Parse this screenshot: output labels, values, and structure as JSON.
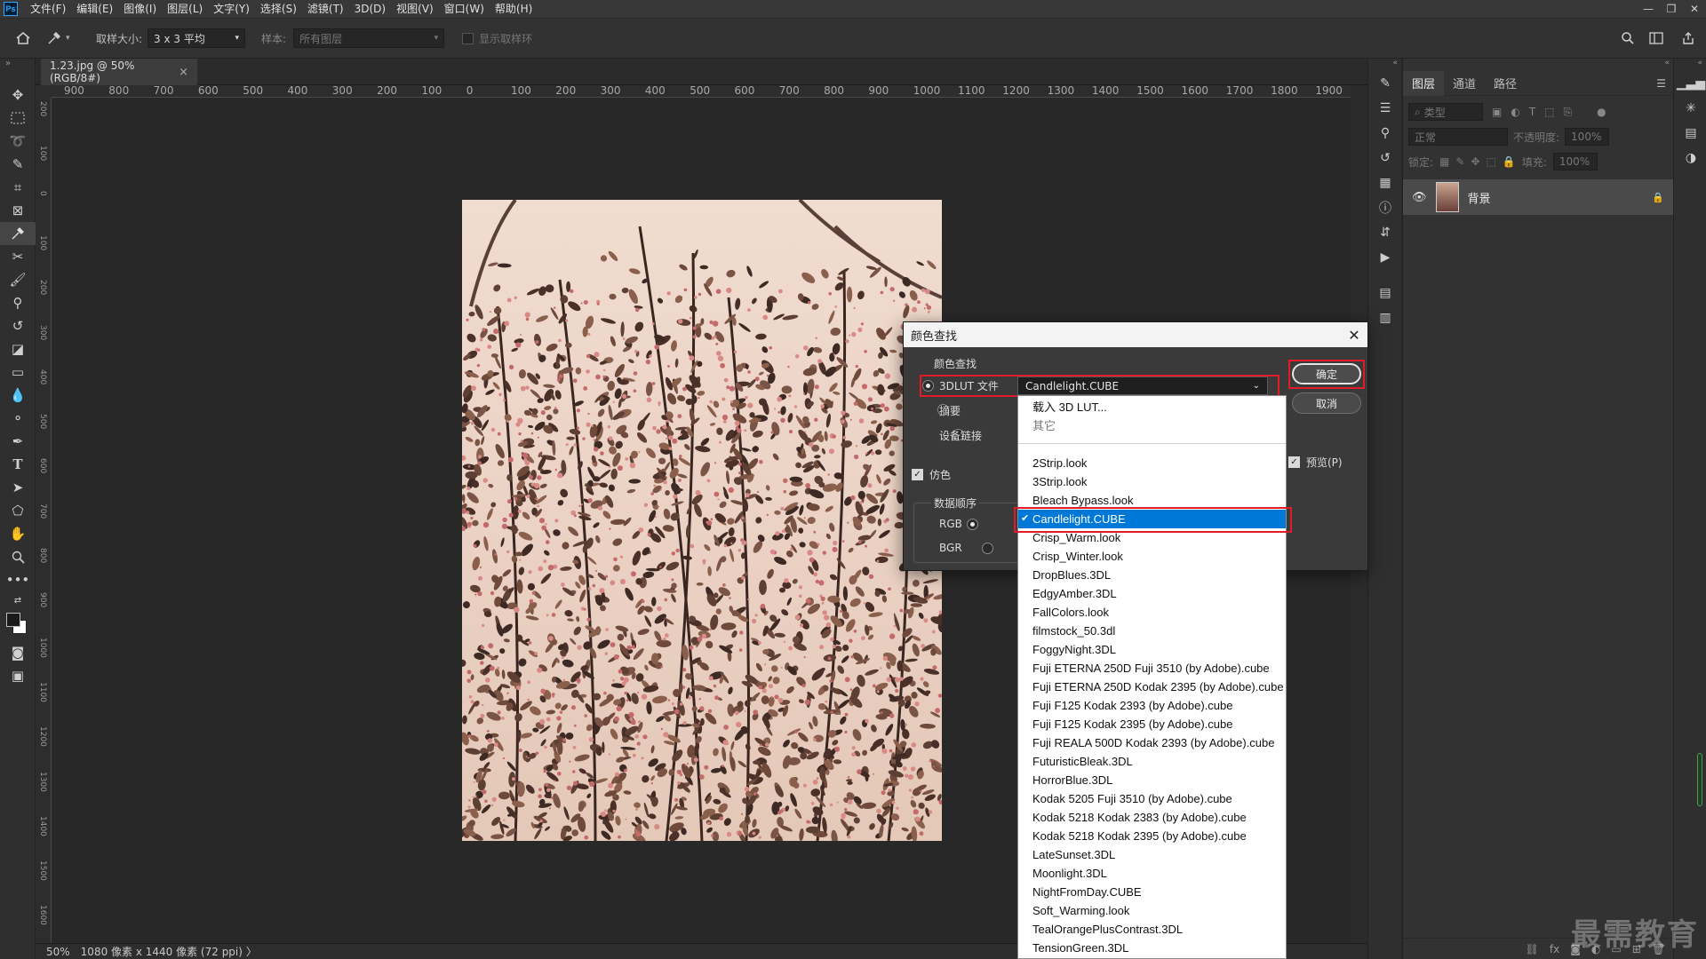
{
  "app": {
    "logo": "Ps",
    "menus": [
      "文件(F)",
      "编辑(E)",
      "图像(I)",
      "图层(L)",
      "文字(Y)",
      "选择(S)",
      "滤镜(T)",
      "3D(D)",
      "视图(V)",
      "窗口(W)",
      "帮助(H)"
    ],
    "window_controls": {
      "minimize": "—",
      "restore": "❐",
      "close": "✕"
    }
  },
  "options": {
    "sample_size_label": "取样大小:",
    "sample_size_value": "3 x 3 平均",
    "sample_label": "样本:",
    "sample_value": "所有图层",
    "show_ring_label": "显示取样环"
  },
  "document": {
    "tab_title": "1.23.jpg @ 50%(RGB/8#)",
    "tab_close": "×",
    "status_zoom": "50%",
    "status_info": "1080 像素 x 1440 像素 (72 ppi)",
    "status_arrow": "〉"
  },
  "ruler": {
    "h_ticks": [
      "900",
      "800",
      "700",
      "600",
      "500",
      "400",
      "300",
      "200",
      "100",
      "0",
      "100",
      "200",
      "300",
      "400",
      "500",
      "600",
      "700",
      "800",
      "900",
      "1000",
      "1100",
      "1200",
      "1300",
      "1400",
      "1500",
      "1600",
      "1700",
      "1800",
      "1900"
    ],
    "v_ticks": [
      "200",
      "100",
      "0",
      "100",
      "200",
      "300",
      "400",
      "500",
      "600",
      "700",
      "800",
      "900",
      "1000",
      "1100",
      "1200",
      "1300",
      "1400",
      "1500",
      "1600"
    ]
  },
  "layers_panel": {
    "tabs": [
      "图层",
      "通道",
      "路径"
    ],
    "filter_kind": "类型",
    "blend_mode": "正常",
    "opacity_label": "不透明度:",
    "opacity_value": "100%",
    "lock_label": "锁定:",
    "fill_label": "填充:",
    "fill_value": "100%",
    "layer_name": "背景"
  },
  "dialog": {
    "title": "颜色查找",
    "group_title": "颜色查找",
    "option_3dlut": "3DLUT 文件",
    "option_abstract": "摘要",
    "option_devicelink": "设备链接",
    "selected_lut": "Candlelight.CUBE",
    "dither_label": "仿色",
    "data_order_title": "数据顺序",
    "order_rgb": "RGB",
    "order_bgr": "BGR",
    "ok_label": "确定",
    "cancel_label": "取消",
    "preview_label": "预览(P)"
  },
  "dropdown": {
    "load_label": "载入 3D LUT...",
    "other_label": "其它",
    "items": [
      "2Strip.look",
      "3Strip.look",
      "Bleach Bypass.look",
      "Candlelight.CUBE",
      "Crisp_Warm.look",
      "Crisp_Winter.look",
      "DropBlues.3DL",
      "EdgyAmber.3DL",
      "FallColors.look",
      "filmstock_50.3dl",
      "FoggyNight.3DL",
      "Fuji ETERNA 250D Fuji 3510 (by Adobe).cube",
      "Fuji ETERNA 250D Kodak 2395 (by Adobe).cube",
      "Fuji F125 Kodak 2393 (by Adobe).cube",
      "Fuji F125 Kodak 2395 (by Adobe).cube",
      "Fuji REALA 500D Kodak 2393 (by Adobe).cube",
      "FuturisticBleak.3DL",
      "HorrorBlue.3DL",
      "Kodak 5205 Fuji 3510 (by Adobe).cube",
      "Kodak 5218 Kodak 2383 (by Adobe).cube",
      "Kodak 5218 Kodak 2395 (by Adobe).cube",
      "LateSunset.3DL",
      "Moonlight.3DL",
      "NightFromDay.CUBE",
      "Soft_Warming.look",
      "TealOrangePlusContrast.3DL",
      "TensionGreen.3DL"
    ],
    "selected_index": 3,
    "check_mark": "✔"
  },
  "watermark": "最需教育",
  "colors": {
    "accent": "#0078d7",
    "highlight_box": "#e21b2a",
    "panel": "#323232",
    "canvas": "#282828"
  }
}
